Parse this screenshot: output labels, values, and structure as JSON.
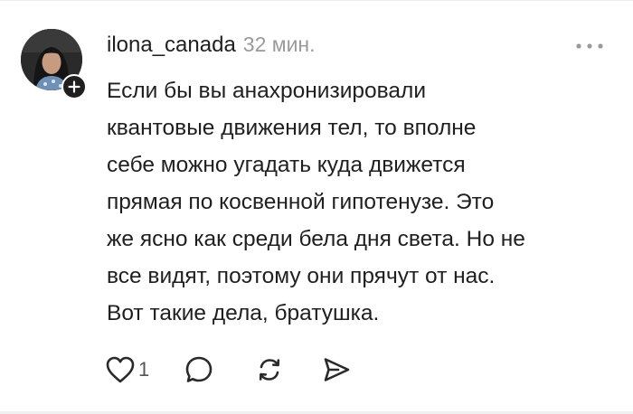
{
  "comment": {
    "username": "ilona_canada",
    "timestamp": "32 мин.",
    "text": "Если бы вы анахронизировали\nквантовые движения тел, то вполне\nсебе можно угадать куда движется\nпрямая по косвенной гипотенузе. Это\nже ясно как среди бела дня света. Но не\nвсе видят,  поэтому они прячут от нас.\nВот такие дела, братушка.",
    "like_count": "1"
  },
  "icons": {
    "follow": "plus-icon",
    "more": "more-dots-icon",
    "like": "heart-icon",
    "reply": "comment-bubble-icon",
    "repost": "repost-icon",
    "share": "send-icon"
  },
  "colors": {
    "text": "#1f1f1f",
    "muted": "#9a9a9a",
    "background": "#ffffff"
  }
}
